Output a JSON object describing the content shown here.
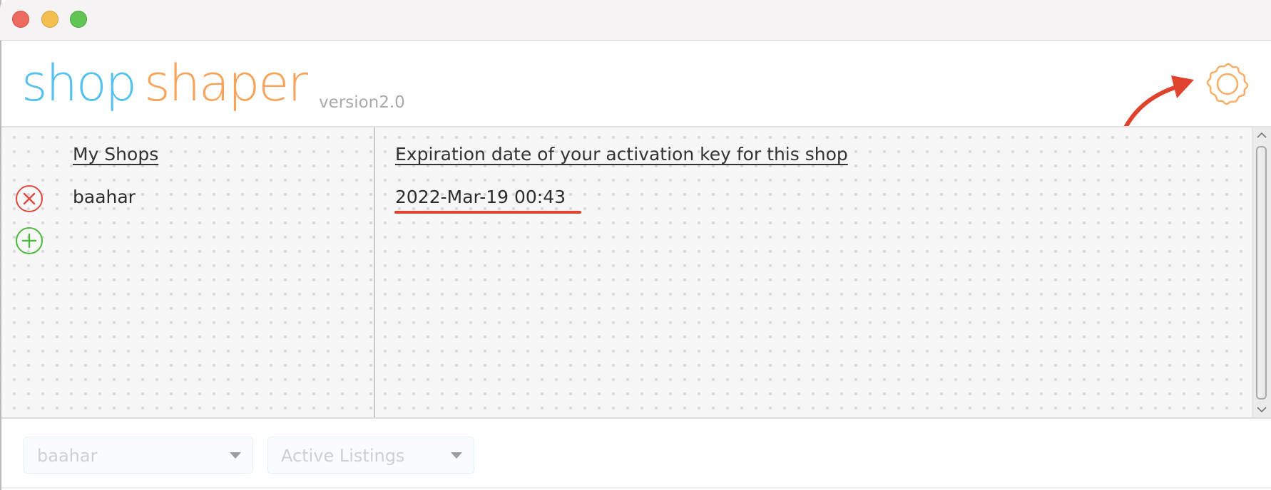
{
  "window": {
    "controls": [
      "close",
      "minimize",
      "maximize"
    ]
  },
  "header": {
    "logo_part1": "shop",
    "logo_part2": "shaper",
    "version": "version2.0",
    "settings_icon": "gear-icon",
    "annotation_icon": "curved-arrow-icon"
  },
  "colors": {
    "logo_blue": "#55c1ee",
    "logo_orange": "#f8a35a",
    "remove_red": "#e3483f",
    "add_green": "#4bb93d",
    "annotation_red": "#e0432d"
  },
  "shops_panel": {
    "header": "My Shops",
    "shops": [
      {
        "name": "baahar",
        "remove_icon": "remove-circle-icon"
      }
    ],
    "add_icon": "add-circle-icon"
  },
  "expiration_panel": {
    "header": "Expiration date of your activation key for this shop",
    "dates": [
      "2022-Mar-19 00:43"
    ]
  },
  "footer": {
    "shop_select": {
      "value": "baahar"
    },
    "listing_select": {
      "value": "Active Listings"
    }
  }
}
